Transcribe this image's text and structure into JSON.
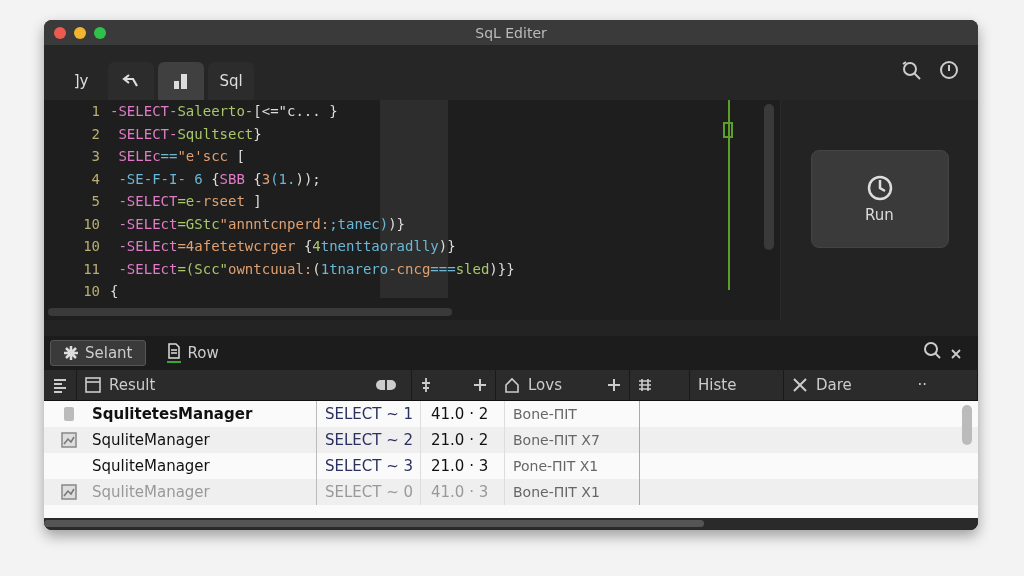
{
  "window": {
    "title": "SqL Editer"
  },
  "toolbar": {
    "tool_buttons": [
      {
        "kind": "glyph",
        "label": "]y",
        "selected": false
      },
      {
        "kind": "undo",
        "selected": false
      },
      {
        "kind": "chart",
        "selected": true
      },
      {
        "kind": "text",
        "label": "Sql",
        "selected": false
      }
    ]
  },
  "editor": {
    "lines": [
      {
        "number": "1",
        "segments": [
          {
            "kind": "kw",
            "text": "-SELECT-"
          },
          {
            "kind": "id",
            "text": "Saleerto-"
          },
          {
            "kind": "pn",
            "text": "[<=\"c... }"
          }
        ]
      },
      {
        "number": "2",
        "segments": [
          {
            "kind": "kw",
            "text": " SELECT-"
          },
          {
            "kind": "id",
            "text": "Squltsect"
          },
          {
            "kind": "pn",
            "text": "}"
          }
        ]
      },
      {
        "number": "3",
        "segments": [
          {
            "kind": "kw",
            "text": " SELEc"
          },
          {
            "kind": "fn",
            "text": "=="
          },
          {
            "kind": "str",
            "text": "\"e'scc"
          },
          {
            "kind": "pn",
            "text": " ["
          }
        ]
      },
      {
        "number": "4",
        "segments": [
          {
            "kind": "fn",
            "text": " -SE-F-I- 6 "
          },
          {
            "kind": "pn",
            "text": "{"
          },
          {
            "kind": "kw",
            "text": "SBB"
          },
          {
            "kind": "pn",
            "text": " {"
          },
          {
            "kind": "str",
            "text": "3"
          },
          {
            "kind": "fn",
            "text": "(1."
          },
          {
            "kind": "pn",
            "text": "));"
          }
        ]
      },
      {
        "number": "5",
        "segments": [
          {
            "kind": "kw",
            "text": " -SELECT"
          },
          {
            "kind": "id",
            "text": "=e"
          },
          {
            "kind": "str",
            "text": "-rseet"
          },
          {
            "kind": "pn",
            "text": " ]"
          }
        ]
      },
      {
        "number": "10",
        "segments": [
          {
            "kind": "kw",
            "text": " -SELEct"
          },
          {
            "kind": "id",
            "text": "=GStc"
          },
          {
            "kind": "str",
            "text": "\"annntcnperd:"
          },
          {
            "kind": "fn",
            "text": ";tanec)"
          },
          {
            "kind": "pn",
            "text": ")}"
          }
        ]
      },
      {
        "number": "10",
        "segments": [
          {
            "kind": "kw",
            "text": " -SELEct"
          },
          {
            "kind": "str",
            "text": "=4afetetwcrger"
          },
          {
            "kind": "pn",
            "text": " {"
          },
          {
            "kind": "id",
            "text": "4"
          },
          {
            "kind": "fn",
            "text": "tnenttaoradlly"
          },
          {
            "kind": "pn",
            "text": ")}"
          }
        ]
      },
      {
        "number": "11",
        "segments": [
          {
            "kind": "kw",
            "text": " -SELEct"
          },
          {
            "kind": "id",
            "text": "=(Scc\""
          },
          {
            "kind": "str",
            "text": "owntcuual:"
          },
          {
            "kind": "pn",
            "text": "("
          },
          {
            "kind": "fn",
            "text": "1tnarero"
          },
          {
            "kind": "str",
            "text": "-cncg"
          },
          {
            "kind": "fn",
            "text": "==="
          },
          {
            "kind": "id",
            "text": "sled"
          },
          {
            "kind": "pn",
            "text": ")}}"
          }
        ]
      },
      {
        "number": "10",
        "segments": [
          {
            "kind": "pn",
            "text": "{"
          }
        ]
      }
    ]
  },
  "run_button": {
    "label": "Run"
  },
  "results": {
    "tabs": [
      {
        "label": "Selant",
        "selected": true
      },
      {
        "label": "Row",
        "selected": false
      }
    ],
    "header": [
      {
        "kind": "result",
        "label": "Result"
      },
      {
        "kind": "lovs",
        "label": "Lovs"
      },
      {
        "kind": "histe",
        "label": "Histe"
      },
      {
        "kind": "dare",
        "label": "Dare"
      },
      {
        "kind": "more",
        "label": "··"
      }
    ],
    "rows": [
      {
        "name": "SqulitetesManager",
        "query": "SELECT ~ 1",
        "value": "41.0 · 2",
        "note": "Bone-ΠΙΤ",
        "kind": "blank",
        "dimmed": false
      },
      {
        "name": "SquliteManager",
        "query": "SELECT ~ 2",
        "value": "21.0 · 2",
        "note": "Bone-ΠΙΤ X7",
        "kind": "image",
        "dimmed": false
      },
      {
        "name": "SquliteManager",
        "query": "SELECT ~ 3",
        "value": "21.0 · 3",
        "note": "Pone-ΠΙΤ X1",
        "kind": "none",
        "dimmed": false
      },
      {
        "name": "SquliteManager",
        "query": "SELECT ~ 0",
        "value": "41.0 · 3",
        "note": "Bone-ΠΙΤ X1",
        "kind": "image",
        "dimmed": true
      }
    ]
  }
}
